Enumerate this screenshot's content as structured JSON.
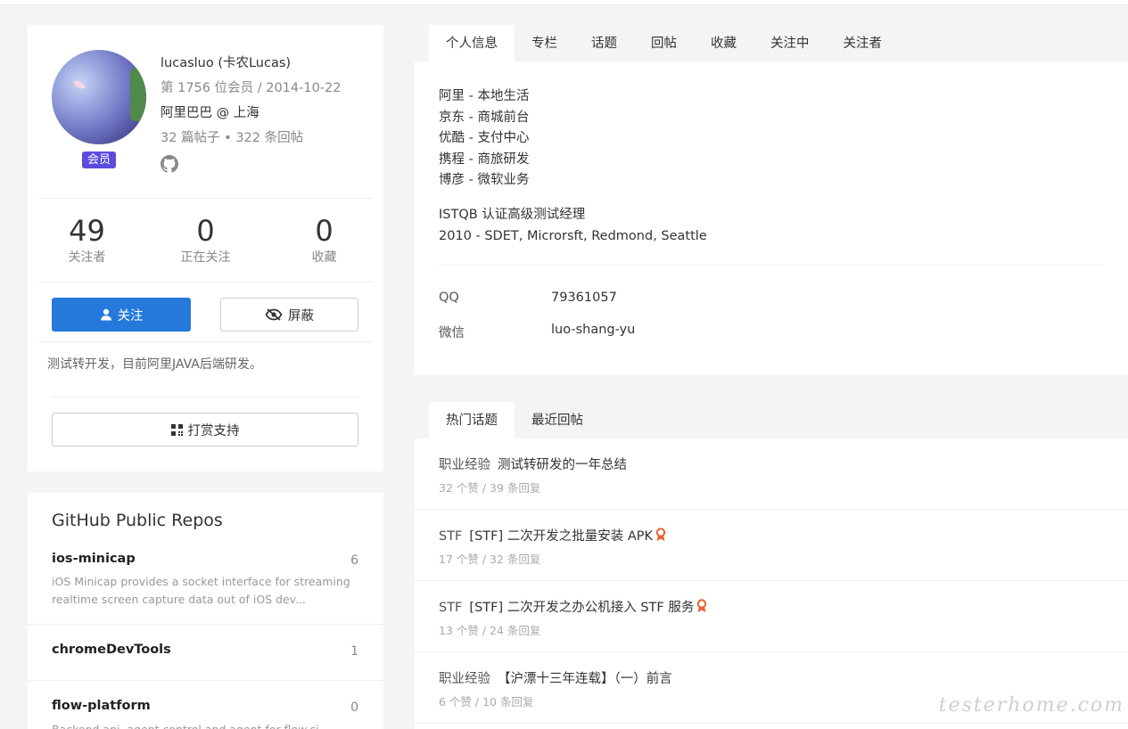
{
  "profile": {
    "name": "lucasluo (卡农Lucas)",
    "member_no": "第 1756 位会员 / 2014-10-22",
    "company": "阿里巴巴 @ 上海",
    "counts": "32 篇帖子 • 322 条回帖",
    "badge": "会员",
    "stats": [
      {
        "num": "49",
        "label": "关注者"
      },
      {
        "num": "0",
        "label": "正在关注"
      },
      {
        "num": "0",
        "label": "收藏"
      }
    ],
    "follow_label": "关注",
    "block_label": "屏蔽",
    "bio": "测试转开发，目前阿里JAVA后端研发。",
    "donate_label": "打赏支持",
    "accent": "#2479db",
    "badge_color": "#5b4ce0"
  },
  "repos": {
    "title": "GitHub Public Repos",
    "items": [
      {
        "name": "ios-minicap",
        "count": "6",
        "desc": "iOS Minicap provides a socket interface for streaming realtime screen capture data out of iOS dev..."
      },
      {
        "name": "chromeDevTools",
        "count": "1",
        "desc": ""
      },
      {
        "name": "flow-platform",
        "count": "0",
        "desc": "Backend api, agent control and agent for flow.ci"
      }
    ]
  },
  "profile_tabs": [
    "个人信息",
    "专栏",
    "话题",
    "回帖",
    "收藏",
    "关注中",
    "关注者"
  ],
  "info": {
    "lines": [
      "阿里 - 本地生活",
      "京东 - 商城前台",
      "优酷 - 支付中心",
      "携程 - 商旅研发",
      "博彦 - 微软业务"
    ],
    "istqb": [
      "ISTQB 认证高级测试经理",
      "2010 - SDET, Microrsft, Redmond, Seattle"
    ],
    "contacts": [
      {
        "key": "QQ",
        "value": "79361057"
      },
      {
        "key": "微信",
        "value": "luo-shang-yu"
      }
    ]
  },
  "topic_tabs": [
    "热门话题",
    "最近回帖"
  ],
  "topics": [
    {
      "node": "职业经验",
      "title": "测试转研发的一年总结",
      "meta": "32 个赞 / 39 条回复",
      "award": false
    },
    {
      "node": "STF",
      "title": "[STF] 二次开发之批量安装 APK",
      "meta": "17 个赞 / 32 条回复",
      "award": true
    },
    {
      "node": "STF",
      "title": "[STF] 二次开发之办公机接入 STF 服务",
      "meta": "13 个赞 / 24 条回复",
      "award": true
    },
    {
      "node": "职业经验",
      "title": "【沪漂十三年连载】（一）前言",
      "meta": "6 个赞 / 10 条回复",
      "award": false
    }
  ],
  "watermark": "testerhome.com"
}
